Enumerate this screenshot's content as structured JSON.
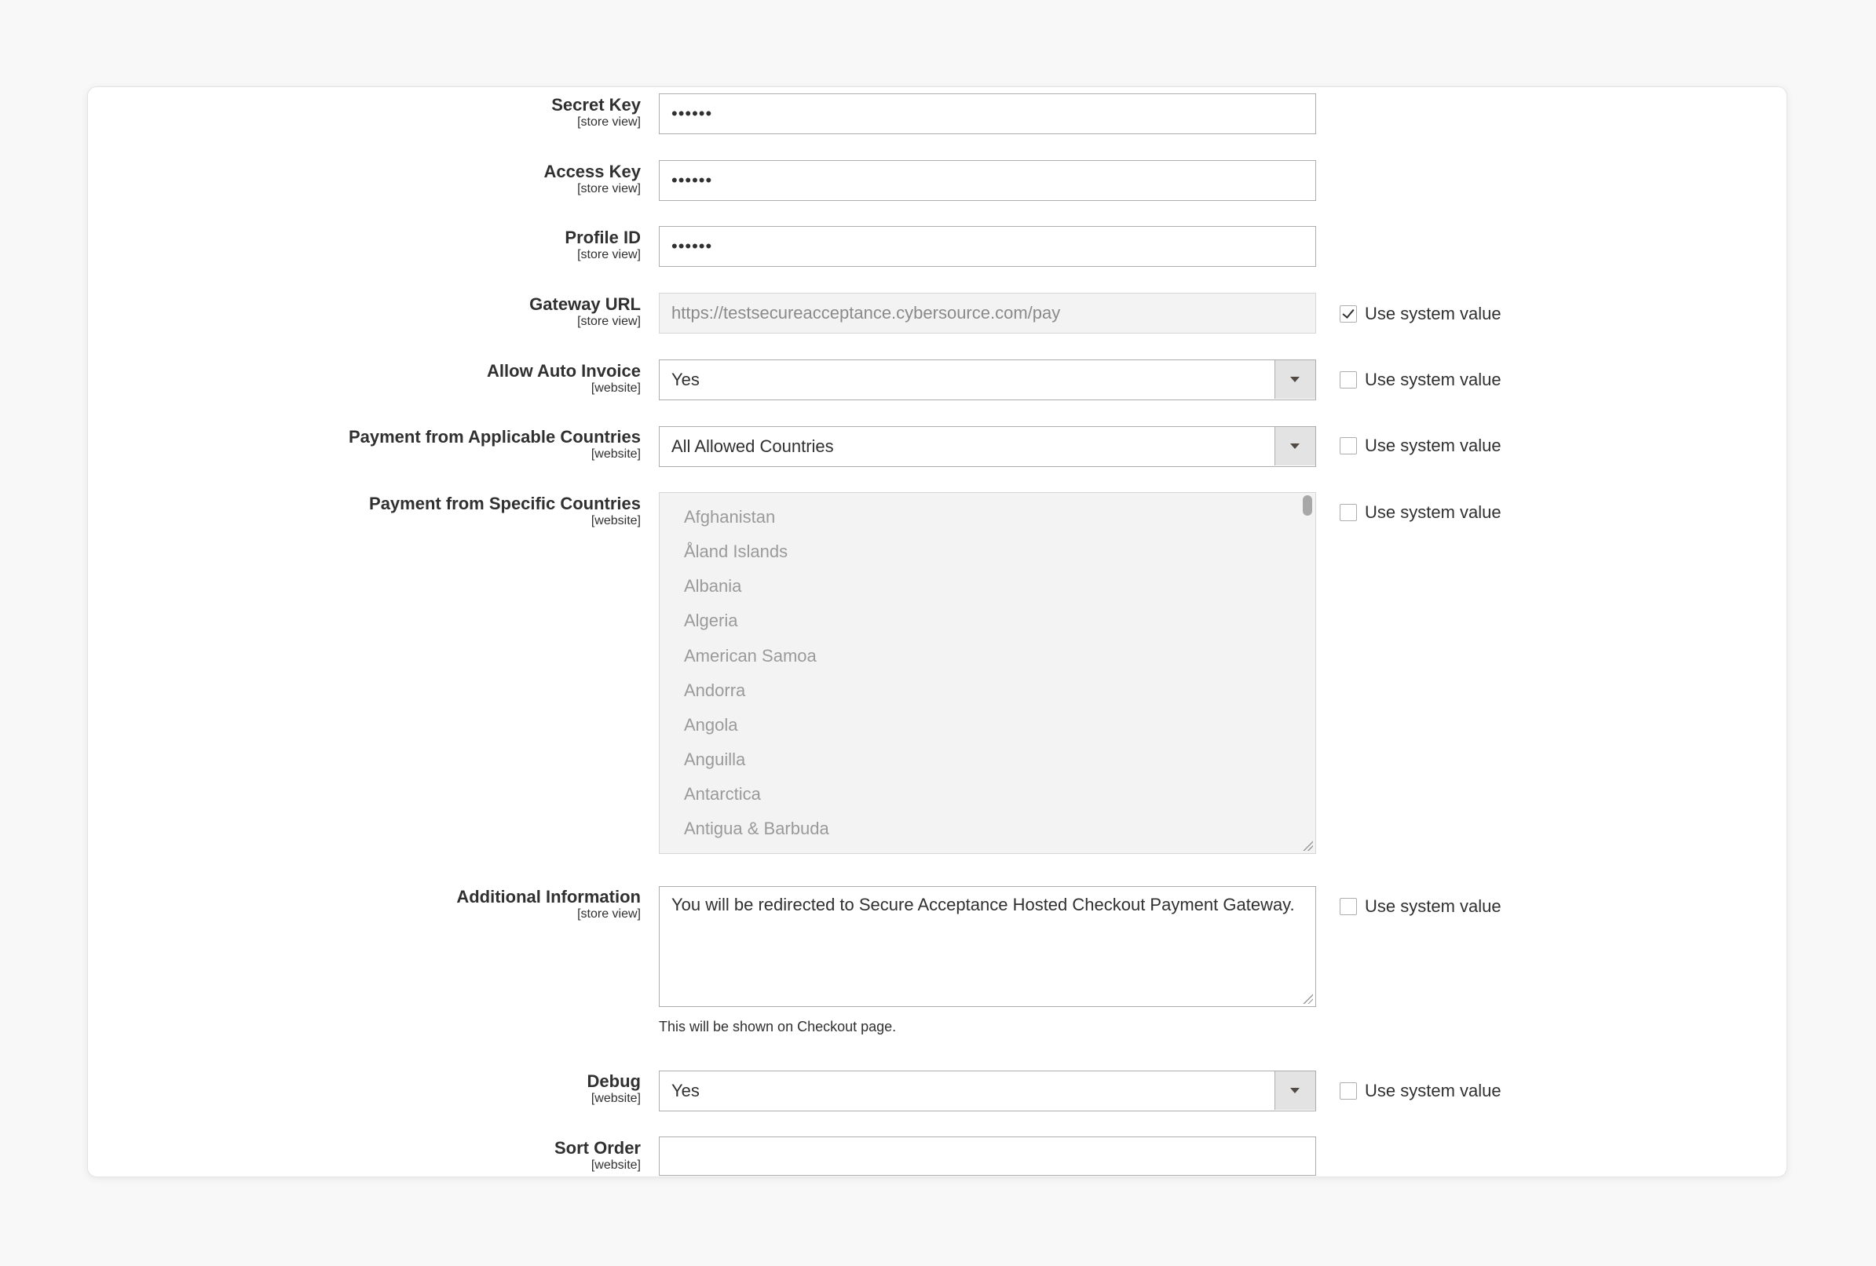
{
  "fields": {
    "secret_key": {
      "label": "Secret Key",
      "scope": "[store view]",
      "value": "••••••"
    },
    "access_key": {
      "label": "Access Key",
      "scope": "[store view]",
      "value": "••••••"
    },
    "profile_id": {
      "label": "Profile ID",
      "scope": "[store view]",
      "value": "••••••"
    },
    "gateway_url": {
      "label": "Gateway URL",
      "scope": "[store view]",
      "value": "https://testsecureacceptance.cybersource.com/pay",
      "use_system_value": true
    },
    "allow_auto_invoice": {
      "label": "Allow Auto Invoice",
      "scope": "[website]",
      "value": "Yes",
      "use_system_value": false
    },
    "applicable_countries": {
      "label": "Payment from Applicable Countries",
      "scope": "[website]",
      "value": "All Allowed Countries",
      "use_system_value": false
    },
    "specific_countries": {
      "label": "Payment from Specific Countries",
      "scope": "[website]",
      "use_system_value": false,
      "options": [
        "Afghanistan",
        "Åland Islands",
        "Albania",
        "Algeria",
        "American Samoa",
        "Andorra",
        "Angola",
        "Anguilla",
        "Antarctica",
        "Antigua & Barbuda"
      ]
    },
    "additional_info": {
      "label": "Additional Information",
      "scope": "[store view]",
      "value": "You will be redirected to Secure Acceptance Hosted Checkout Payment Gateway.",
      "note": "This will be shown on Checkout page.",
      "use_system_value": false
    },
    "debug": {
      "label": "Debug",
      "scope": "[website]",
      "value": "Yes",
      "use_system_value": false
    },
    "sort_order": {
      "label": "Sort Order",
      "scope": "[website]",
      "value": ""
    }
  },
  "use_system_value_label": "Use system value"
}
